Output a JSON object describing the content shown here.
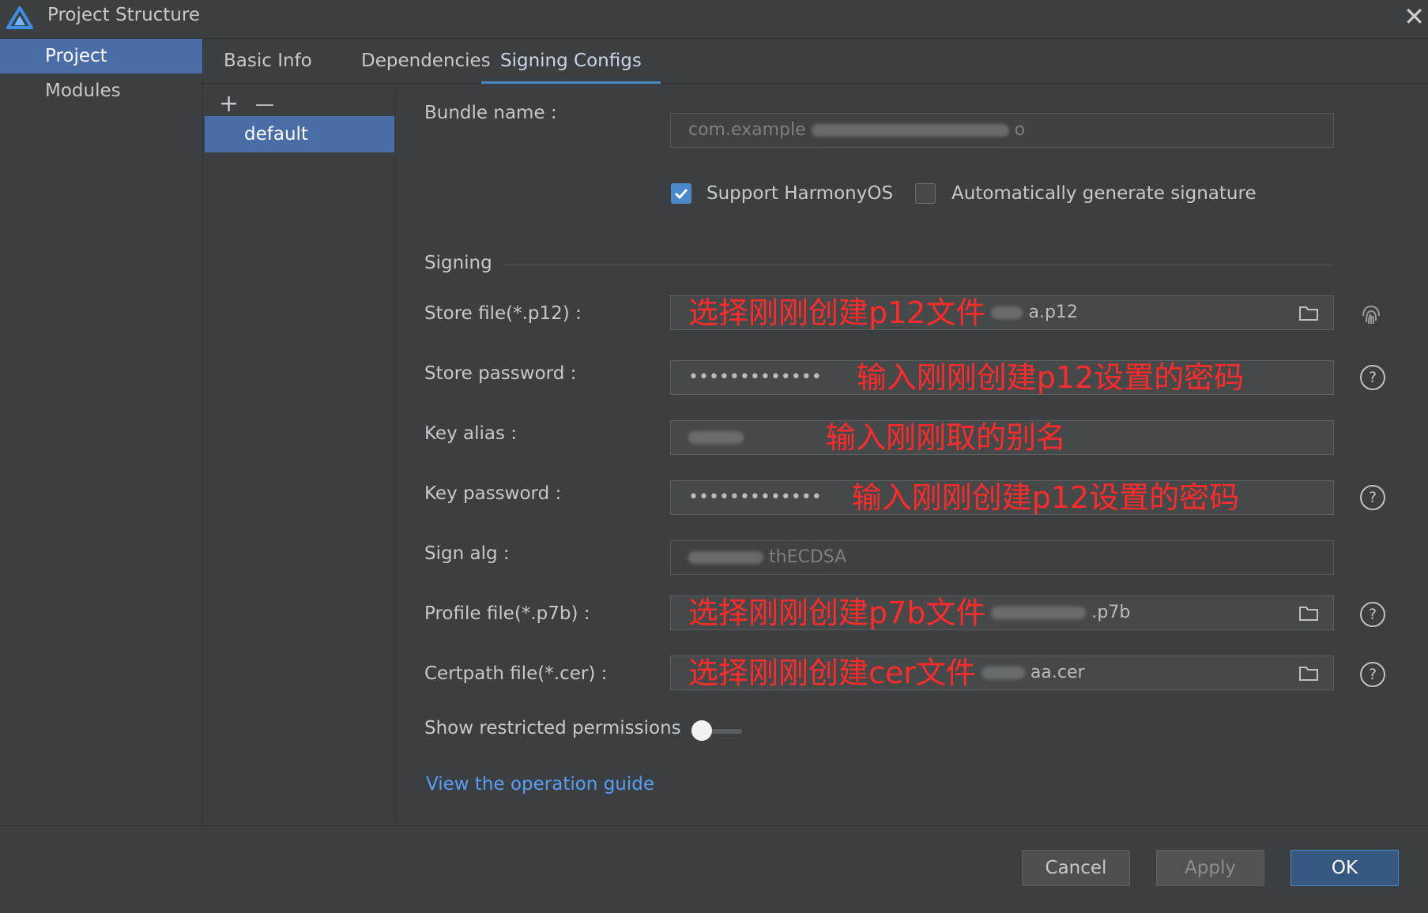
{
  "window": {
    "title": "Project Structure"
  },
  "sidebar": {
    "items": [
      {
        "label": "Project"
      },
      {
        "label": "Modules"
      }
    ]
  },
  "tabs": [
    {
      "label": "Basic Info"
    },
    {
      "label": "Dependencies"
    },
    {
      "label": "Signing Configs"
    }
  ],
  "configs": {
    "add": "+",
    "remove": "—",
    "items": [
      {
        "label": "default"
      }
    ]
  },
  "form": {
    "bundle_name": {
      "label": "Bundle name :",
      "value_prefix": "com.example",
      "value_suffix": "o"
    },
    "support_harmonyos": {
      "label": "Support HarmonyOS",
      "checked": true
    },
    "auto_sign": {
      "label": "Automatically generate signature",
      "checked": false
    },
    "signing_section": "Signing",
    "store_file": {
      "label": "Store file(*.p12) :",
      "value_suffix": "a.p12",
      "annotation": "选择刚刚创建p12文件"
    },
    "store_password": {
      "label": "Store password :",
      "value": "•••••••••••••",
      "annotation": "输入刚刚创建p12设置的密码"
    },
    "key_alias": {
      "label": "Key alias :",
      "annotation": "输入刚刚取的别名"
    },
    "key_password": {
      "label": "Key password :",
      "value": "•••••••••••••",
      "annotation": "输入刚刚创建p12设置的密码"
    },
    "sign_alg": {
      "label": "Sign alg :",
      "value_suffix": "thECDSA"
    },
    "profile_file": {
      "label": "Profile file(*.p7b) :",
      "value_suffix": ".p7b",
      "annotation": "选择刚刚创建p7b文件"
    },
    "certpath_file": {
      "label": "Certpath file(*.cer) :",
      "value_suffix": "aa.cer",
      "annotation": "选择刚刚创建cer文件"
    },
    "restricted": {
      "label": "Show restricted permissions",
      "enabled": false
    },
    "guide_link": "View the operation guide"
  },
  "footer": {
    "cancel": "Cancel",
    "apply": "Apply",
    "ok": "OK"
  },
  "colors": {
    "accent": "#4a88c7",
    "selection": "#4a6da7",
    "annotation": "#ff2a2a",
    "link": "#589df6"
  }
}
